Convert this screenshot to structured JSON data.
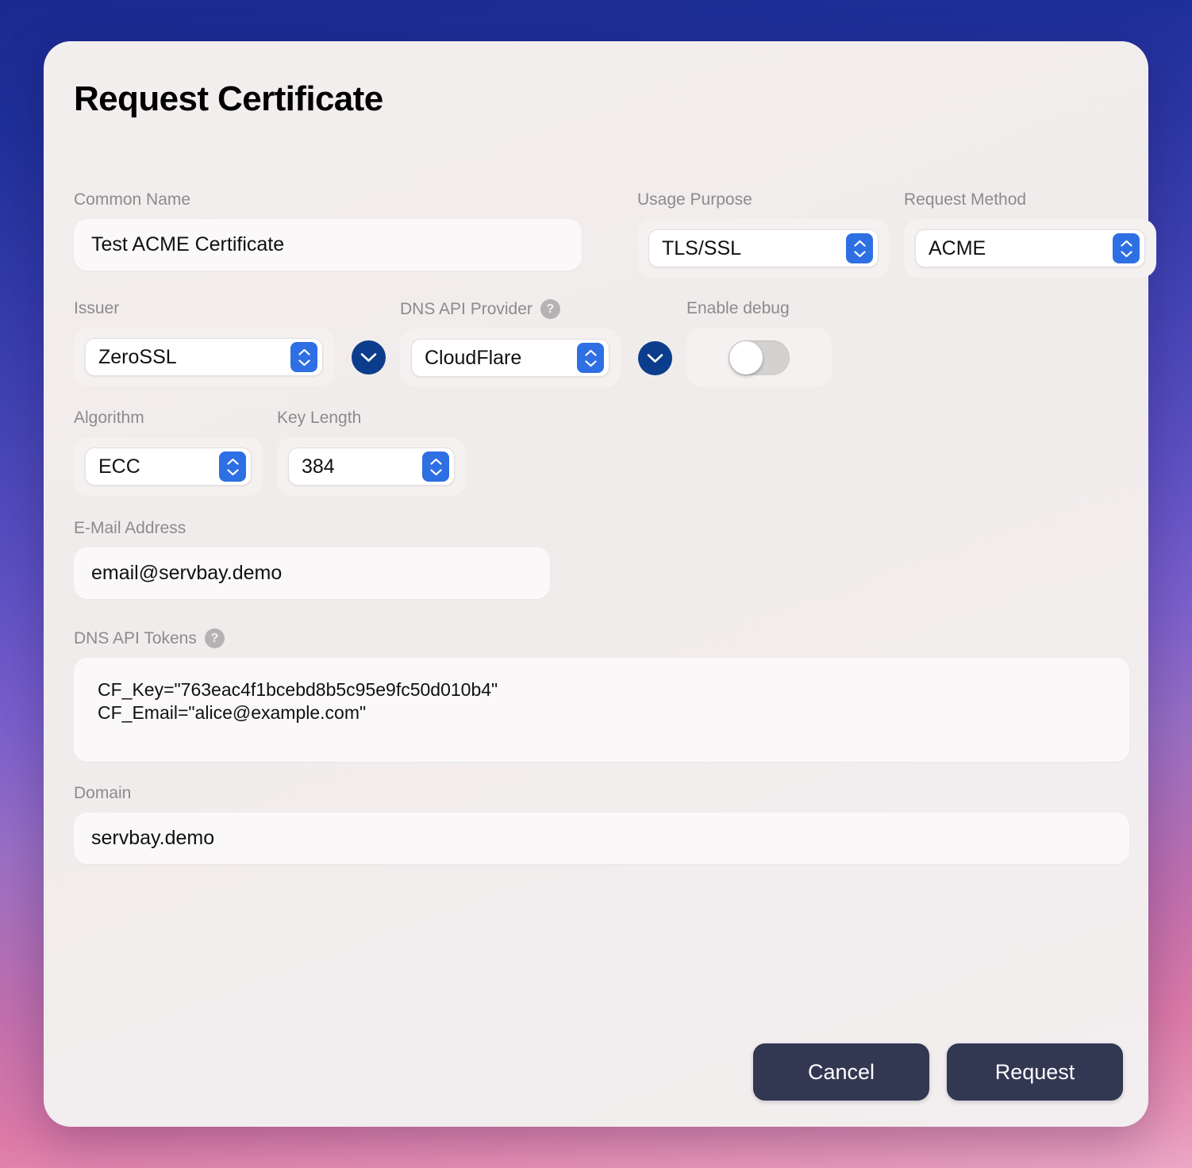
{
  "dialog": {
    "title": "Request Certificate"
  },
  "fields": {
    "common_name": {
      "label": "Common Name",
      "value": "Test ACME Certificate"
    },
    "usage_purpose": {
      "label": "Usage Purpose",
      "value": "TLS/SSL"
    },
    "request_method": {
      "label": "Request Method",
      "value": "ACME"
    },
    "issuer": {
      "label": "Issuer",
      "value": "ZeroSSL"
    },
    "dns_api_provider": {
      "label": "DNS API Provider",
      "value": "CloudFlare",
      "help": "?"
    },
    "enable_debug": {
      "label": "Enable debug",
      "state": "off"
    },
    "algorithm": {
      "label": "Algorithm",
      "value": "ECC"
    },
    "key_length": {
      "label": "Key Length",
      "value": "384"
    },
    "email_address": {
      "label": "E-Mail Address",
      "value": "email@servbay.demo"
    },
    "dns_api_tokens": {
      "label": "DNS API Tokens",
      "help": "?",
      "value": "CF_Key=\"763eac4f1bcebd8b5c95e9fc50d010b4\"\nCF_Email=\"alice@example.com\""
    },
    "domain": {
      "label": "Domain",
      "value": "servbay.demo"
    }
  },
  "footer": {
    "cancel_label": "Cancel",
    "request_label": "Request"
  },
  "colors": {
    "accent_blue": "#2f6fe4",
    "navy_button": "#0b3d8c",
    "footer_button": "#323752",
    "card_background": "#f2eeed",
    "label_text": "#8d8a8c"
  }
}
